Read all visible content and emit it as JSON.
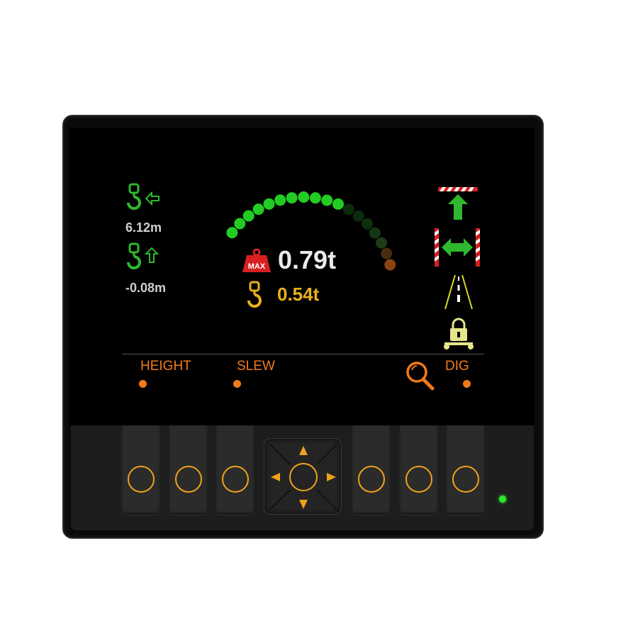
{
  "readouts": {
    "radius_value": "6.12m",
    "height_value": "-0.08m",
    "max_load": "0.79t",
    "hook_load": "0.54t",
    "max_badge": "MAX"
  },
  "gauge": {
    "lit_count": 11,
    "dim_count": 7,
    "lit_color": "#22cc22",
    "dim_colors": [
      "#0c2a0c",
      "#0c2a0c",
      "#0e2e0e",
      "#133613",
      "#1d3b16",
      "#4a2b10",
      "#8a4412"
    ],
    "load_fraction": 0.61
  },
  "modes": {
    "height": "HEIGHT",
    "slew": "SLEW",
    "dig": "DIG"
  },
  "colors": {
    "accent": "#f07a1a",
    "key_ring": "#f0a21a",
    "hook_green": "#2fb82f",
    "hook_yellow": "#e8b21c",
    "status_green": "#2ee82e"
  },
  "icons": {
    "radius": "hook-arrow-left-icon",
    "height": "hook-arrow-up-icon",
    "max_load": "weight-max-icon",
    "hook_load": "hook-icon",
    "height_limit": "height-limit-icon",
    "slew_limit": "slew-limit-icon",
    "road": "road-icon",
    "lock": "chassis-lock-icon",
    "zoom": "magnifier-icon"
  }
}
